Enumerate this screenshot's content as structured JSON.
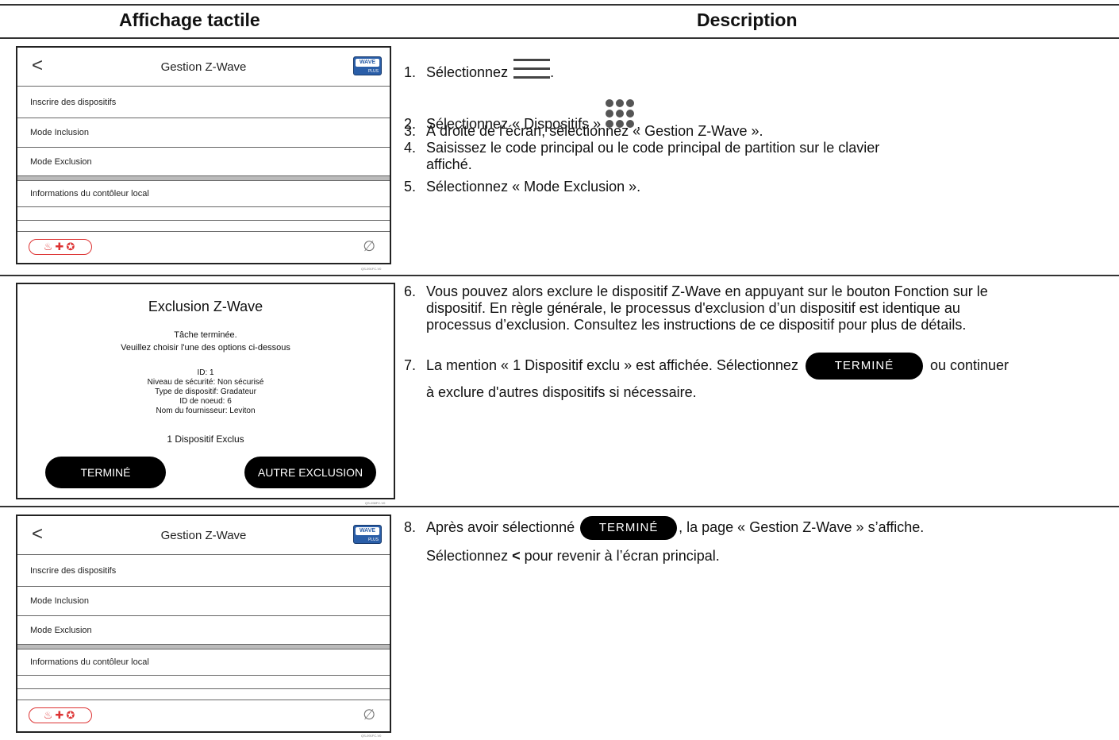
{
  "headers": {
    "left": "Affichage tactile",
    "right": "Description"
  },
  "screen1": {
    "title": "Gestion Z-Wave",
    "back": "<",
    "badge_top": "WAVE",
    "badge_bottom": "PLUS",
    "rows": [
      "Inscrire des dispositifs",
      "Mode Inclusion",
      "Mode Exclusion",
      "Informations du contôleur local"
    ],
    "emergency": "♨✚✪",
    "ref": "QS-091FC-V0"
  },
  "screen2": {
    "title": "Exclusion Z-Wave",
    "line1": "Tâche terminée.",
    "line2": "Veuillez choisir l'une des options ci-dessous",
    "info": [
      "ID: 1",
      "Niveau de sécurité: Non sécurisé",
      "Type de dispositif: Gradateur",
      "ID de noeud: 6",
      "Nom du fournisseur: Leviton"
    ],
    "count": "1 Dispositif Exclus",
    "btn_done": "TERMINÉ",
    "btn_more": "AUTRE EXCLUSION",
    "ref": "QS-098FC-V0"
  },
  "screen3": {
    "title": "Gestion Z-Wave",
    "back": "<",
    "badge_top": "WAVE",
    "badge_bottom": "PLUS",
    "rows": [
      "Inscrire des dispositifs",
      "Mode Inclusion",
      "Mode Exclusion",
      "Informations du contôleur local"
    ],
    "emergency": "♨✚✪",
    "ref": "QS-091FC-V0"
  },
  "steps": {
    "s1": {
      "num": "1.",
      "text": "Sélectionnez",
      "after": "."
    },
    "s2": {
      "num": "2.",
      "text": "Sélectionnez « Dispositifs »",
      "after": "."
    },
    "s3": {
      "num": "3.",
      "text": "À droite de l’écran, sélectionnez « Gestion Z-Wave »."
    },
    "s4": {
      "num": "4.",
      "text": "Saisissez le code principal ou le code principal de partition sur le clavier",
      "text2": "affiché."
    },
    "s5": {
      "num": "5.",
      "text": "Sélectionnez « Mode Exclusion »."
    },
    "s6": {
      "num": "6.",
      "l1": "Vous pouvez alors exclure le dispositif Z-Wave en appuyant sur le bouton Fonction sur le",
      "l2": "dispositif. En règle générale, le processus d'exclusion d’un dispositif est identique au",
      "l3": "processus d’exclusion. Consultez les instructions de ce dispositif pour plus de détails."
    },
    "s7": {
      "num": "7.",
      "pre": "La mention « 1 Dispositif exclu » est affichée. Sélectionnez",
      "pill": "TERMINÉ",
      "post": "ou continuer",
      "l2": "à exclure d'autres dispositifs si nécessaire."
    },
    "s8": {
      "num": "8.",
      "pre": "Après avoir sélectionné",
      "pill": "TERMINÉ",
      "post": ", la page « Gestion Z-Wave » s’affiche.",
      "l2a": "Sélectionnez",
      "l2b": "<",
      "l2c": "pour revenir à l’écran principal."
    }
  }
}
